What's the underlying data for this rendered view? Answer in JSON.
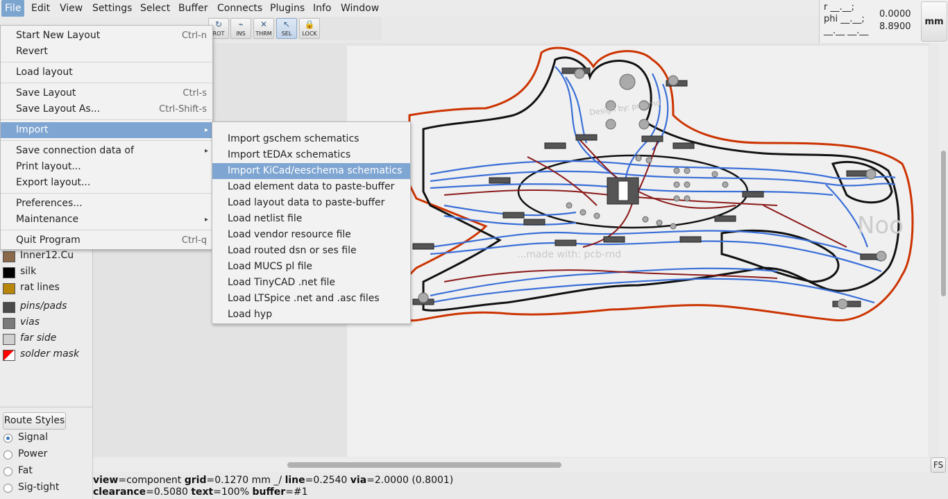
{
  "menubar": {
    "items": [
      "File",
      "Edit",
      "View",
      "Settings",
      "Select",
      "Buffer",
      "Connects",
      "Plugins",
      "Info",
      "Window"
    ]
  },
  "toolbar": {
    "buttons": [
      {
        "label": "ROT",
        "icon": "rotate-icon",
        "glyph": "↻"
      },
      {
        "label": "INS",
        "icon": "insert-icon",
        "glyph": "⌁"
      },
      {
        "label": "THRM",
        "icon": "thermal-icon",
        "glyph": "✕"
      },
      {
        "label": "SEL",
        "icon": "select-arrow-icon",
        "glyph": "↖"
      },
      {
        "label": "LOCK",
        "icon": "lock-icon",
        "glyph": "🔒"
      }
    ]
  },
  "coords": {
    "r_line": "r __.__;",
    "phi_line": "phi __.__;",
    "blank_line": "__.__ __.__",
    "x": "0.0000",
    "y": "8.8900",
    "unit": "mm"
  },
  "file_menu": {
    "items": [
      {
        "label": "Start New Layout",
        "accel": "Ctrl-n"
      },
      {
        "label": "Revert",
        "accel": ""
      },
      {
        "label": "Load layout",
        "accel": ""
      },
      {
        "label": "Save Layout",
        "accel": "Ctrl-s"
      },
      {
        "label": "Save Layout As...",
        "accel": "Ctrl-Shift-s"
      },
      {
        "label": "Import",
        "accel": ""
      },
      {
        "label": "Save connection data of",
        "accel": ""
      },
      {
        "label": "Print layout...",
        "accel": ""
      },
      {
        "label": "Export layout...",
        "accel": ""
      },
      {
        "label": "Preferences...",
        "accel": ""
      },
      {
        "label": "Maintenance",
        "accel": ""
      },
      {
        "label": "Quit Program",
        "accel": "Ctrl-q"
      }
    ]
  },
  "import_menu": {
    "items": [
      "Import gschem schematics",
      "Import tEDAx schematics",
      "Import KiCad/eeschema schematics",
      "Load element data to paste-buffer",
      "Load layout data to paste-buffer",
      "Load netlist file",
      "Load vendor resource file",
      "Load routed dsn or ses file",
      "Load MUCS pl file",
      "Load TinyCAD .net file",
      "Load LTSpice .net and .asc files",
      "Load hyp"
    ]
  },
  "layers": [
    {
      "label": "Inner12.Cu",
      "color": "#8b6a4b"
    },
    {
      "label": "silk",
      "color": "#000000"
    },
    {
      "label": "rat lines",
      "color": "#b8860b"
    },
    {
      "label": "pins/pads",
      "color": "#4a4a4a"
    },
    {
      "label": "vias",
      "color": "#7a7a7a"
    },
    {
      "label": "far side",
      "color": "#d0d0d0"
    },
    {
      "label": "solder mask",
      "color": "#ff0000"
    }
  ],
  "route_styles": {
    "button": "Route Styles",
    "options": [
      "Signal",
      "Power",
      "Fat",
      "Sig-tight"
    ],
    "selected": "Signal"
  },
  "status": {
    "line1": [
      {
        "k": "view",
        "v": "=component "
      },
      {
        "k": "grid",
        "v": "=0.1270 mm  _/  "
      },
      {
        "k": "line",
        "v": "=0.2540 "
      },
      {
        "k": "via",
        "v": "=2.0000 (0.8001)"
      }
    ],
    "line2": [
      {
        "k": "clearance",
        "v": "=0.5080 "
      },
      {
        "k": "text",
        "v": "=100% "
      },
      {
        "k": "buffer",
        "v": "=#1"
      }
    ]
  },
  "fs_button": "FS",
  "board_texts": {
    "designed": "Design by: pcb-rnd",
    "designed2": "...made with: pcb-rnd",
    "name": "Noo"
  }
}
